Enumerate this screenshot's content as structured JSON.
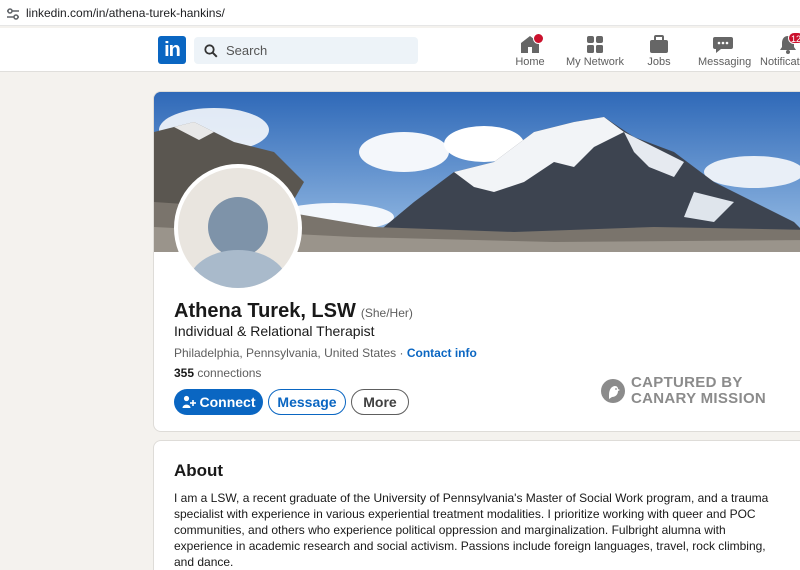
{
  "browser": {
    "url": "linkedin.com/in/athena-turek-hankins/"
  },
  "nav": {
    "logo": "in",
    "search_placeholder": "Search",
    "items": [
      {
        "label": "Home",
        "icon": "home-icon",
        "badge": ""
      },
      {
        "label": "My Network",
        "icon": "network-icon",
        "badge": ""
      },
      {
        "label": "Jobs",
        "icon": "briefcase-icon",
        "badge": ""
      },
      {
        "label": "Messaging",
        "icon": "chat-icon",
        "badge": ""
      },
      {
        "label": "Notifications",
        "icon": "bell-icon",
        "badge": "12"
      }
    ]
  },
  "profile": {
    "name": "Athena Turek, LSW",
    "pronouns": "(She/Her)",
    "headline": "Individual & Relational Therapist",
    "location": "Philadelphia, Pennsylvania, United States",
    "separator": "·",
    "contact_info": "Contact info",
    "connections_count": "355",
    "connections_label": "connections",
    "buttons": {
      "connect": "Connect",
      "message": "Message",
      "more": "More"
    }
  },
  "watermark": {
    "line1": "CAPTURED BY",
    "line2": "CANARY MISSION"
  },
  "about": {
    "title": "About",
    "text": "I am a LSW, a recent graduate of the University of Pennsylvania's Master of Social Work program, and a trauma specialist with experience in various experiential treatment modalities. I prioritize working with queer and POC communities, and others who experience political oppression and marginalization. Fulbright alumna with experience in academic research and social activism. Passions include foreign languages, travel, rock climbing, and dance."
  },
  "colors": {
    "brand": "#0a66c2",
    "badge": "#cb112d",
    "page_bg": "#f4f2ee"
  }
}
